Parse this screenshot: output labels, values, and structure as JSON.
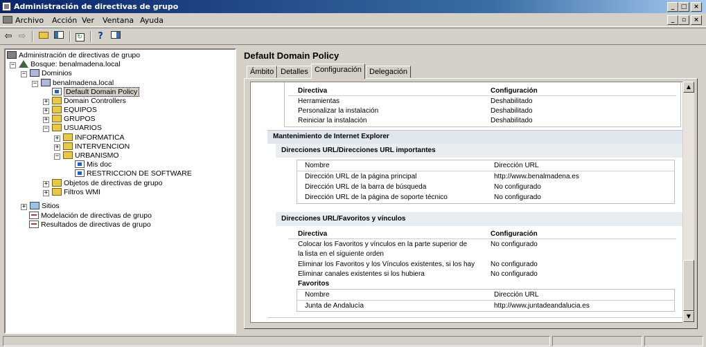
{
  "window": {
    "title": "Administración de directivas de grupo",
    "minimize": "_",
    "maximize": "□",
    "close": "×"
  },
  "menubar": {
    "items": [
      "Archivo",
      "Acción",
      "Ver",
      "Ventana",
      "Ayuda"
    ],
    "right_controls": [
      "_",
      "▫",
      "×"
    ]
  },
  "toolbar": {
    "buttons": [
      "back-icon",
      "forward-icon",
      "up-folder-icon",
      "show-hide-tree-icon",
      "refresh-icon",
      "help-icon",
      "properties-icon"
    ]
  },
  "tree": {
    "root": "Administración de directivas de grupo",
    "forest": "Bosque: benalmadena.local",
    "domains": "Dominios",
    "domain": "benalmadena.local",
    "default_policy": "Default Domain Policy",
    "dc": "Domain Controllers",
    "equipos": "EQUIPOS",
    "grupos": "GRUPOS",
    "usuarios": "USUARIOS",
    "informatica": "INFORMATICA",
    "intervencion": "INTERVENCION",
    "urbanismo": "URBANISMO",
    "misdoc": "Mis doc",
    "restriccion": "RESTRICCION DE SOFTWARE",
    "gpo_objects": "Objetos de directivas de grupo",
    "wmi": "Filtros WMI",
    "sitios": "Sitios",
    "modelacion": "Modelación de directivas de grupo",
    "resultados": "Resultados de directivas de grupo"
  },
  "right": {
    "title": "Default Domain Policy",
    "tabs": [
      "Ámbito",
      "Detalles",
      "Configuración",
      "Delegación"
    ],
    "report": {
      "col_directiva": "Directiva",
      "col_config": "Configuración",
      "rows1": [
        {
          "d": "Herramientas",
          "c": "Deshabilitado"
        },
        {
          "d": "Personalizar la instalación",
          "c": "Deshabilitado"
        },
        {
          "d": "Reiniciar la instalación",
          "c": "Deshabilitado"
        }
      ],
      "section_ie": "Mantenimiento de Internet Explorer",
      "sub_urls": "Direcciones URL/Direcciones URL importantes",
      "url_col_name": "Nombre",
      "url_col_addr": "Dirección URL",
      "url_rows": [
        {
          "n": "Dirección URL de la página principal",
          "a": "http://www.benalmadena.es"
        },
        {
          "n": "Dirección URL de la barra de búsqueda",
          "a": "No configurado"
        },
        {
          "n": "Dirección URL de la página de soporte técnico",
          "a": "No configurado"
        }
      ],
      "sub_fav": "Direcciones URL/Favoritos y vínculos",
      "fav_col_directiva": "Directiva",
      "fav_col_config": "Configuración",
      "fav_rows": [
        {
          "d": "Colocar los Favoritos y vínculos en la parte superior de",
          "c": "No configurado"
        },
        {
          "d": "la lista en el siguiente orden",
          "c": ""
        },
        {
          "d": "Eliminar los Favoritos y los Vínculos existentes, si los hay",
          "c": "No configurado"
        },
        {
          "d": "Eliminar canales existentes si los hubiera",
          "c": "No configurado"
        }
      ],
      "favoritos_label": "Favoritos",
      "fav_name_col": "Nombre",
      "fav_addr_col": "Dirección URL",
      "fav_item": {
        "n": "Junta de Andalucía",
        "a": "http://www.juntadeandalucia.es"
      }
    }
  }
}
